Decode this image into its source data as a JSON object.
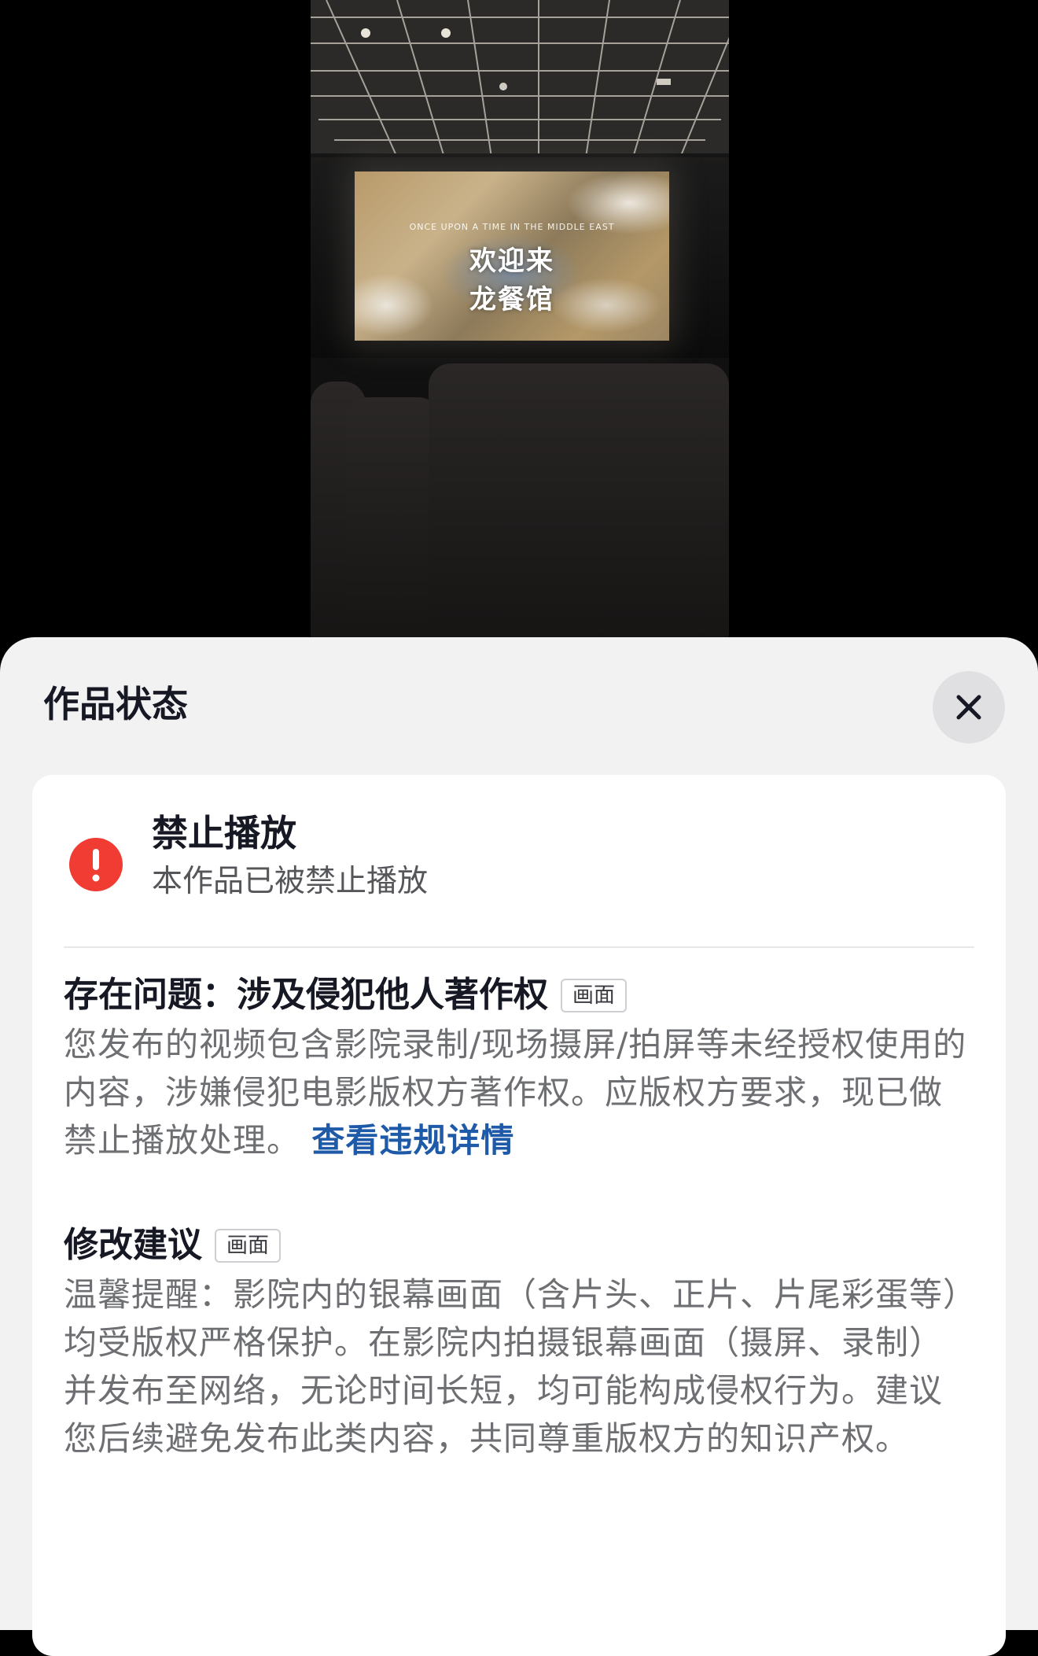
{
  "video": {
    "screen_arc_text": "ONCE UPON A TIME IN THE MIDDLE EAST",
    "screen_title_line1": "欢迎来",
    "screen_title_line2": "龙餐馆"
  },
  "sheet": {
    "title": "作品状态",
    "close_icon": "close-icon"
  },
  "status": {
    "icon": "exclamation-circle-icon",
    "color": "#f03c33",
    "title": "禁止播放",
    "description": "本作品已被禁止播放"
  },
  "issue": {
    "label": "存在问题：涉及侵犯他人著作权",
    "tag": "画面",
    "text": "您发布的视频包含影院录制/现场摄屏/拍屏等未经授权使用的内容，涉嫌侵犯电影版权方著作权。应版权方要求，现已做禁止播放处理。",
    "link": "查看违规详情"
  },
  "suggestion": {
    "label": "修改建议",
    "tag": "画面",
    "text": "温馨提醒：影院内的银幕画面（含片头、正片、片尾彩蛋等）均受版权严格保护。在影院内拍摄银幕画面（摄屏、录制）并发布至网络，无论时间长短，均可能构成侵权行为。建议您后续避免发布此类内容，共同尊重版权方的知识产权。"
  }
}
